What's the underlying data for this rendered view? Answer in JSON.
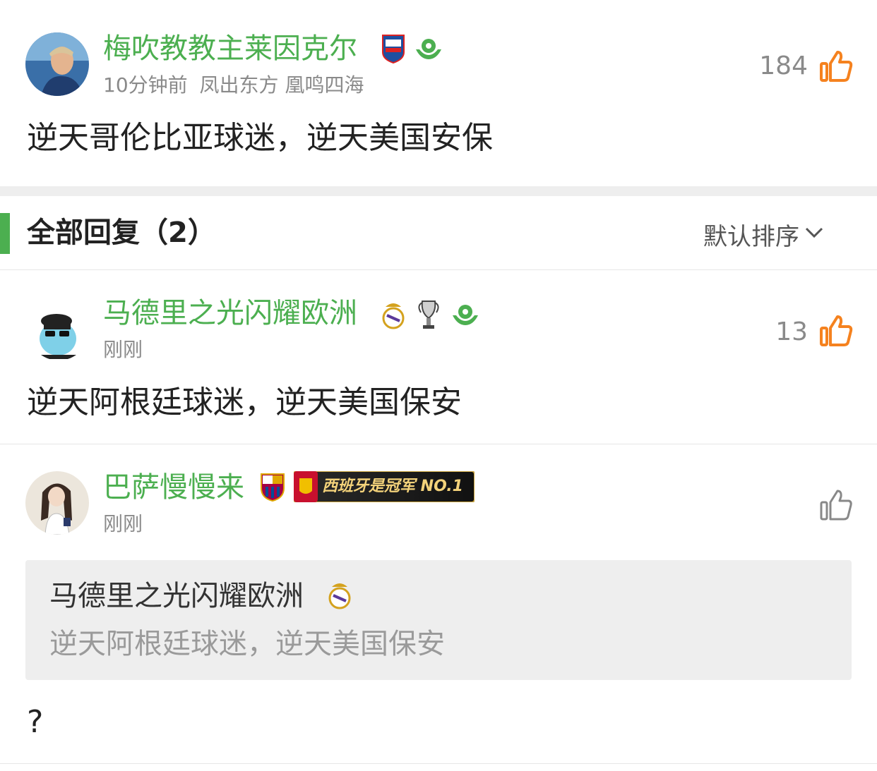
{
  "main_comment": {
    "username": "梅吹教教主莱因克尔",
    "time": "10分钟前",
    "tags": "凤出东方 凰鸣四海",
    "text": "逆天哥伦比亚球迷，逆天美国安保",
    "likes": "184",
    "badges": [
      "club-badge-icon",
      "green-football-icon"
    ]
  },
  "replies_header": {
    "title": "全部回复（2）",
    "sort_label": "默认排序"
  },
  "replies": [
    {
      "username": "马德里之光闪耀欧洲",
      "time": "刚刚",
      "text": "逆天阿根廷球迷，逆天美国保安",
      "likes": "13",
      "badges": [
        "real-madrid-badge-icon",
        "champions-trophy-icon",
        "green-football-icon"
      ]
    },
    {
      "username": "巴萨慢慢来",
      "time": "刚刚",
      "badge_banner": "西班牙是冠军 NO.1",
      "quote": {
        "username": "马德里之光闪耀欧洲",
        "text": "逆天阿根廷球迷，逆天美国保安"
      },
      "text": "?",
      "likes": "",
      "badges": [
        "barcelona-badge-icon",
        "spain-champion-banner"
      ]
    }
  ],
  "colors": {
    "accent_green": "#4caf50",
    "like_orange": "#f5821f",
    "text": "#222222",
    "meta_gray": "#8a8a8a",
    "quote_bg": "#eeeeee"
  }
}
